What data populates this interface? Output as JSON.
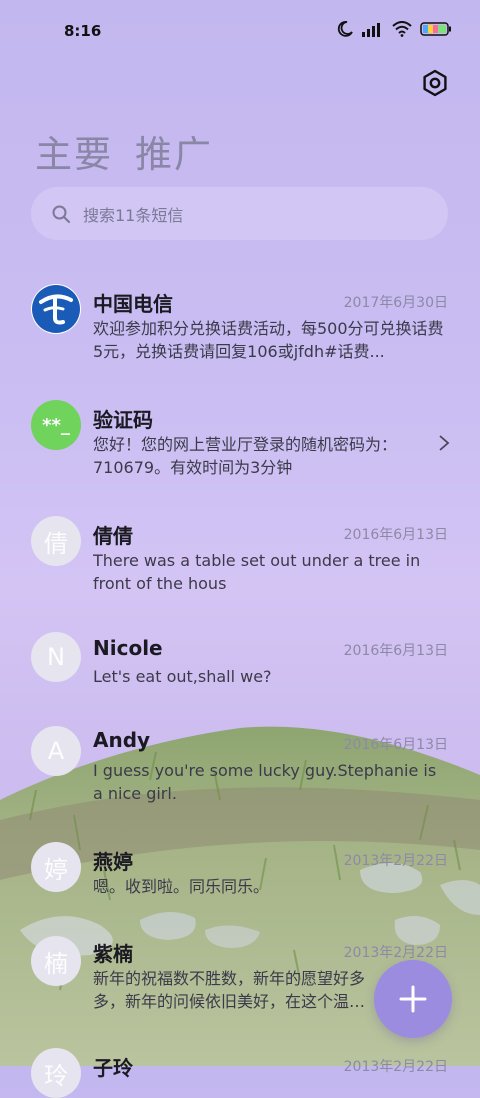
{
  "status_bar": {
    "time": "8:16"
  },
  "tabs": [
    {
      "label": "主要"
    },
    {
      "label": "推广"
    }
  ],
  "search": {
    "placeholder": "搜索11条短信"
  },
  "messages": [
    {
      "sender": "中国电信",
      "date": "2017年6月30日",
      "preview": "欢迎参加积分兑换话费活动，每500分可兑换话费5元，兑换话费请回复106或jfdh#话费...",
      "avatar": "telecom-logo-icon"
    },
    {
      "sender": "验证码",
      "date": "",
      "preview": "您好！您的网上营业厅登录的随机密码为：710679。有效时间为3分钟",
      "avatar_text": "**_"
    },
    {
      "sender": "倩倩",
      "date": "2016年6月13日",
      "preview": "There was a table set out under a tree in front of the hous",
      "avatar_text": "倩"
    },
    {
      "sender": "Nicole",
      "date": "2016年6月13日",
      "preview": "Let's eat out,shall we?",
      "avatar_text": "N"
    },
    {
      "sender": "Andy",
      "date": "2016年6月13日",
      "preview": "I guess you're some lucky guy.Stephanie is a nice girl.",
      "avatar_text": "A"
    },
    {
      "sender": "燕婷",
      "date": "2013年2月22日",
      "preview": "嗯。收到啦。同乐同乐。",
      "avatar_text": "婷"
    },
    {
      "sender": "紫楠",
      "date": "2013年2月22日",
      "preview": "新年的祝福数不胜数，新年的愿望好多多，新年的问候依旧美好，在这个温馨的",
      "avatar_text": "楠"
    },
    {
      "sender": "子玲",
      "date": "2013年2月22日",
      "preview": "",
      "avatar_text": "玲"
    }
  ],
  "colors": {
    "accent": "#9b8ce0",
    "verify_avatar": "#6fd35c",
    "telecom_blue": "#1a5bb8"
  }
}
